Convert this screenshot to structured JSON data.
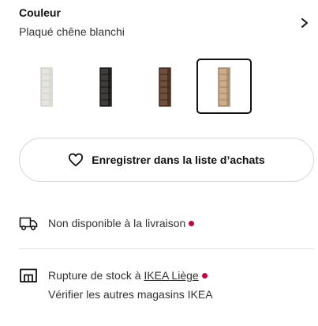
{
  "colour": {
    "label": "Couleur",
    "value": "Plaqué chêne blanchi",
    "chevron_icon": "chevron-right-icon"
  },
  "swatches": [
    {
      "name": "white",
      "color": "#f2f1ec",
      "selected": false
    },
    {
      "name": "black-brown",
      "color": "#2b2a28",
      "selected": false
    },
    {
      "name": "brown",
      "color": "#5a3a2a",
      "selected": false
    },
    {
      "name": "white-stained-oak",
      "color": "#b8987a",
      "selected": true
    }
  ],
  "save_button": {
    "label": "Enregistrer dans la liste d’achats",
    "icon": "heart-icon"
  },
  "delivery": {
    "text": "Non disponible à la livraison",
    "icon": "truck-icon",
    "status_color": "#cc0047"
  },
  "store": {
    "text_prefix": "Rupture de stock à ",
    "store_name": "IKEA Liège",
    "secondary_text": "Vérifier les autres magasins IKEA",
    "icon": "store-icon",
    "status_color": "#cc0047"
  },
  "colors": {
    "selected_border": "#111111",
    "divider": "#dfdfdf"
  }
}
